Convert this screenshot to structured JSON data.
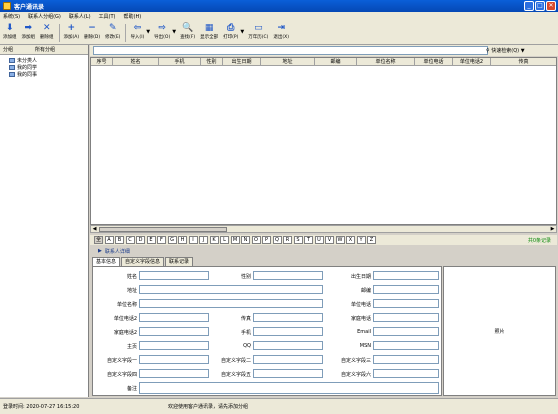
{
  "window": {
    "title": "客户通讯录"
  },
  "menu": [
    "系统(S)",
    "联系人分组(G)",
    "联系人(L)",
    "工具(T)",
    "帮助(H)"
  ],
  "toolbar": [
    {
      "label": "添加组",
      "icon": "add-group-icon",
      "glyph": "⬇"
    },
    {
      "label": "添加组",
      "icon": "add-subgroup-icon",
      "glyph": "➡"
    },
    {
      "label": "删除组",
      "icon": "delete-group-icon",
      "glyph": "✕"
    },
    {
      "label": "添加(A)",
      "icon": "add-icon",
      "glyph": "+"
    },
    {
      "label": "删除(D)",
      "icon": "delete-icon",
      "glyph": "−"
    },
    {
      "label": "修改(E)",
      "icon": "edit-icon",
      "glyph": "✎"
    },
    {
      "label": "导入(I)",
      "icon": "import-icon",
      "glyph": "⇦"
    },
    {
      "label": "导出(O)",
      "icon": "export-icon",
      "glyph": "⇨"
    },
    {
      "label": "查找(F)",
      "icon": "find-icon",
      "glyph": "🔍"
    },
    {
      "label": "显示全部",
      "icon": "show-all-icon",
      "glyph": "▦"
    },
    {
      "label": "打印(P)",
      "icon": "print-icon",
      "glyph": "⎙"
    },
    {
      "label": "万年历(C)",
      "icon": "calendar-icon",
      "glyph": "▭"
    },
    {
      "label": "退出(X)",
      "icon": "exit-icon",
      "glyph": "⇥"
    }
  ],
  "left": {
    "header1": "分组",
    "header2": "所有分组",
    "tree": [
      "未分类人",
      "我的同学",
      "我的同事"
    ]
  },
  "search": {
    "button": "快速检索(Q)"
  },
  "grid": {
    "columns": [
      "序号",
      "姓名",
      "手机",
      "性别",
      "出生日期",
      "地址",
      "邮编",
      "单位名称",
      "单位电话",
      "单位电话2",
      "传真"
    ]
  },
  "letters": [
    "全",
    "A",
    "B",
    "C",
    "D",
    "E",
    "F",
    "G",
    "H",
    "I",
    "J",
    "K",
    "L",
    "M",
    "N",
    "O",
    "P",
    "Q",
    "R",
    "S",
    "T",
    "U",
    "V",
    "W",
    "X",
    "Y",
    "Z"
  ],
  "all_link": "共0条记录",
  "detail": {
    "title": "联系人详细",
    "tabs": [
      "基本信息",
      "自定义字段信息",
      "联系记录"
    ],
    "labels": {
      "name": "姓名",
      "gender": "性别",
      "birthday": "出生日期",
      "address": "地址",
      "zip": "邮编",
      "company": "单位名称",
      "company_phone": "单位电话",
      "company_phone2": "单位电话2",
      "fax": "传真",
      "home_phone": "家庭电话",
      "home_phone2": "家庭电话2",
      "mobile": "手机",
      "email": "Email",
      "homepage": "主页",
      "qq": "QQ",
      "msn": "MSN",
      "custom1": "自定义字段一",
      "custom2": "自定义字段二",
      "custom3": "自定义字段三",
      "custom4": "自定义字段四",
      "custom5": "自定义字段五",
      "custom6": "自定义字段六",
      "note": "备注"
    },
    "photo": "照片"
  },
  "status": {
    "login": "登录时间: 2020-07-27 16:15:20",
    "message": "欢迎使用客户通讯录，请先添加分组"
  }
}
